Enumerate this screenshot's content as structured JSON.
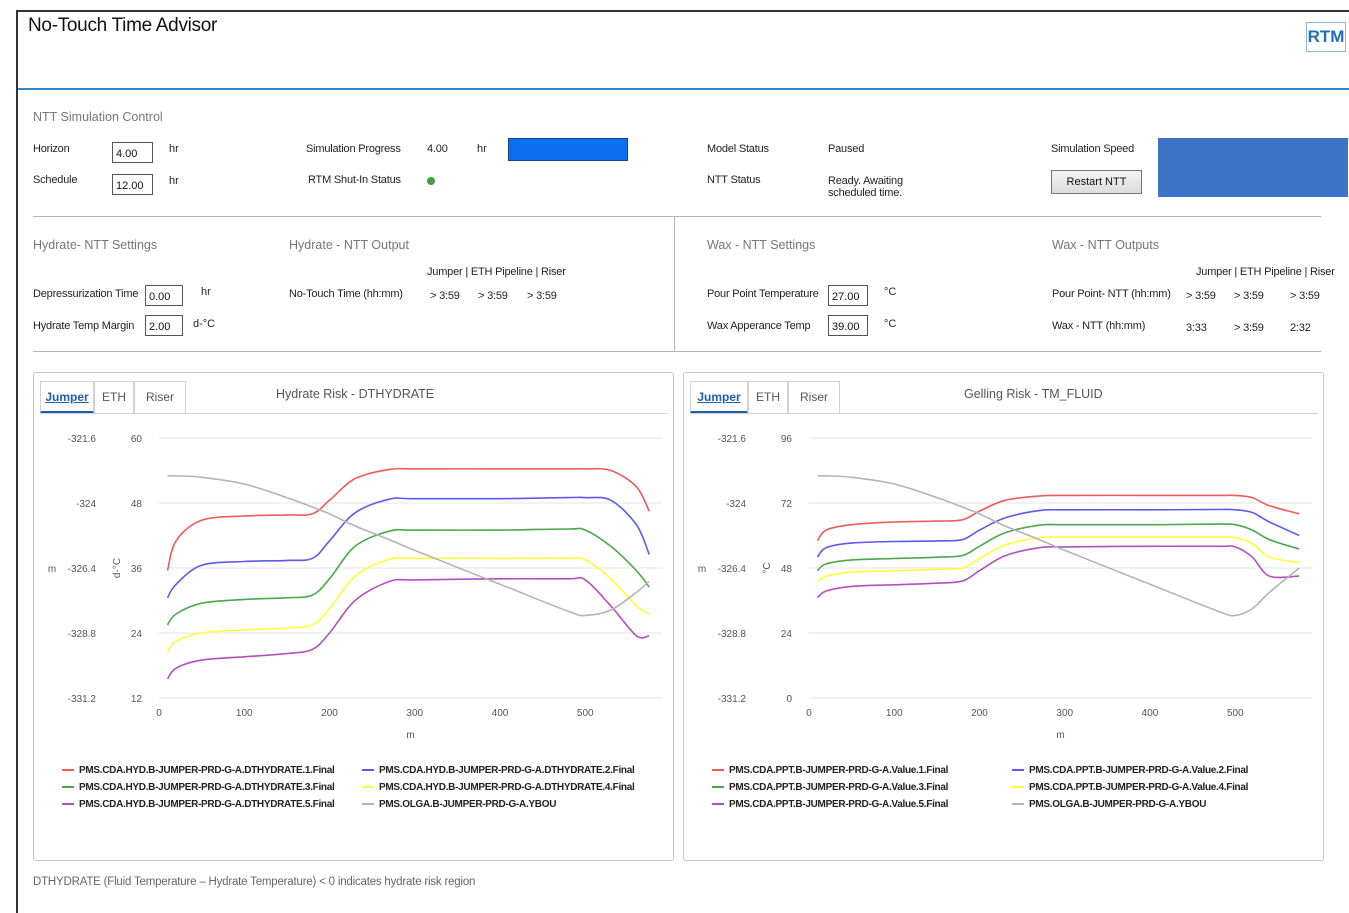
{
  "app": {
    "title": "No-Touch Time Advisor",
    "rtm_tab": "RTM"
  },
  "control": {
    "title": "NTT Simulation Control",
    "horizon_label": "Horizon",
    "horizon_value": "4.00",
    "horizon_unit": "hr",
    "schedule_label": "Schedule",
    "schedule_value": "12.00",
    "schedule_unit": "hr",
    "sim_progress_label": "Simulation Progress",
    "sim_progress_value": "4.00",
    "sim_progress_unit": "hr",
    "progress_fraction": 1.0,
    "rtm_shutin_label": "RTM Shut-In Status",
    "rtm_shutin_color": "#3ba33b",
    "model_status_label": "Model Status",
    "model_status_value": "Paused",
    "ntt_status_label": "NTT Status",
    "ntt_status_value_1": "Ready. Awaiting",
    "ntt_status_value_2": "scheduled time.",
    "sim_speed_label": "Simulation Speed",
    "restart_button": "Restart NTT"
  },
  "hydrate_settings": {
    "title": "Hydrate- NTT Settings",
    "depress_label": "Depressurization Time",
    "depress_value": "0.00",
    "depress_unit": "hr",
    "margin_label": "Hydrate Temp Margin",
    "margin_value": "2.00",
    "margin_unit": "d-°C"
  },
  "hydrate_output": {
    "title": "Hydrate - NTT Output",
    "columns": "Jumper | ETH Pipeline | Riser",
    "ntt_label": "No-Touch Time (hh:mm)",
    "values": [
      "> 3:59",
      "> 3:59",
      "> 3:59"
    ]
  },
  "wax_settings": {
    "title": "Wax - NTT Settings",
    "pour_label": "Pour Point Temperature",
    "pour_value": "27.00",
    "pour_unit": "°C",
    "wat_label": "Wax Apperance Temp",
    "wat_value": "39.00",
    "wat_unit": "°C"
  },
  "wax_output": {
    "title": "Wax - NTT Outputs",
    "columns": "Jumper | ETH Pipeline | Riser",
    "pour_label": "Pour Point- NTT (hh:mm)",
    "pour_values": [
      "> 3:59",
      "> 3:59",
      "> 3:59"
    ],
    "wax_label": "Wax - NTT (hh:mm)",
    "wax_values": [
      "3:33",
      "> 3:59",
      "2:32"
    ]
  },
  "tabs": [
    "Jumper",
    "ETH",
    "Riser"
  ],
  "footnote": "DTHYDRATE (Fluid Temperature – Hydrate Temperature) < 0 indicates hydrate risk region",
  "chart_data": [
    {
      "type": "line",
      "title": "Hydrate Risk - DTHYDRATE",
      "xlabel": "m",
      "ylabel_left": "m",
      "ylabel_right": "d-°C",
      "xlim": [
        0,
        590
      ],
      "x_ticks": [
        "0",
        "100",
        "200",
        "300",
        "400",
        "500"
      ],
      "ylim": [
        12,
        60
      ],
      "y_ticks": [
        "60",
        "48",
        "36",
        "24",
        "12"
      ],
      "y2lim": [
        -331.2,
        -321.6
      ],
      "y2_ticks": [
        "-321.6",
        "-324",
        "-326.4",
        "-328.8",
        "-331.2"
      ],
      "grid": true,
      "legend": "bottom",
      "x": [
        10,
        20,
        50,
        100,
        150,
        180,
        200,
        230,
        270,
        300,
        400,
        480,
        500,
        530,
        560,
        575
      ],
      "series": [
        {
          "name": "PMS.CDA.HYD.B-JUMPER-PRD-G-A.DTHYDRATE.1.Final",
          "color": "#f05a5a",
          "axis": "right",
          "values": [
            35.5,
            41,
            44.8,
            45.6,
            45.8,
            46,
            48.5,
            52.5,
            54.2,
            54.3,
            54.3,
            54.3,
            54.3,
            54,
            51,
            46.5
          ]
        },
        {
          "name": "PMS.CDA.HYD.B-JUMPER-PRD-G-A.DTHYDRATE.2.Final",
          "color": "#5a5af0",
          "axis": "right",
          "values": [
            30.5,
            33,
            36.5,
            37.2,
            37.4,
            37.8,
            41,
            46.2,
            48.7,
            48.8,
            48.8,
            49,
            49,
            48.5,
            44,
            38.5
          ]
        },
        {
          "name": "PMS.CDA.HYD.B-JUMPER-PRD-G-A.DTHYDRATE.3.Final",
          "color": "#4aa84a",
          "axis": "right",
          "values": [
            25.5,
            27.5,
            29.5,
            30.2,
            30.5,
            31,
            34,
            40,
            42.8,
            43,
            43,
            43.2,
            43,
            40,
            35.5,
            32.5
          ]
        },
        {
          "name": "PMS.CDA.HYD.B-JUMPER-PRD-G-A.DTHYDRATE.4.Final",
          "color": "#ffff3a",
          "axis": "right",
          "values": [
            20.5,
            22.5,
            24,
            24.6,
            24.9,
            25.5,
            28.5,
            34.5,
            37.6,
            37.8,
            37.8,
            37.8,
            37.5,
            34,
            29,
            27.5
          ]
        },
        {
          "name": "PMS.CDA.HYD.B-JUMPER-PRD-G-A.DTHYDRATE.5.Final",
          "color": "#b050c0",
          "axis": "right",
          "values": [
            15.5,
            17.5,
            19,
            19.6,
            20.2,
            21,
            24,
            30,
            33.5,
            33.8,
            34,
            34,
            33.8,
            29,
            23.5,
            23.5
          ]
        },
        {
          "name": "PMS.OLGA.B-JUMPER-PRD-G-A.YBOU",
          "color": "#b4b4b4",
          "axis": "left",
          "values": [
            -323.0,
            -323.0,
            -323.05,
            -323.3,
            -323.8,
            -324.15,
            -324.4,
            -324.85,
            -325.35,
            -325.75,
            -327.0,
            -328.0,
            -328.15,
            -327.95,
            -327.3,
            -326.9
          ]
        }
      ]
    },
    {
      "type": "line",
      "title": "Gelling Risk - TM_FLUID",
      "xlabel": "m",
      "ylabel_left": "m",
      "ylabel_right": "°C",
      "xlim": [
        0,
        590
      ],
      "x_ticks": [
        "0",
        "100",
        "200",
        "300",
        "400",
        "500"
      ],
      "ylim": [
        0,
        96
      ],
      "y_ticks": [
        "96",
        "72",
        "48",
        "24",
        "0"
      ],
      "y2lim": [
        -331.2,
        -321.6
      ],
      "y2_ticks": [
        "-321.6",
        "-324",
        "-326.4",
        "-328.8",
        "-331.2"
      ],
      "grid": true,
      "legend": "bottom",
      "x": [
        10,
        20,
        50,
        100,
        150,
        180,
        200,
        230,
        270,
        300,
        400,
        480,
        500,
        520,
        540,
        575
      ],
      "series": [
        {
          "name": "PMS.CDA.PPT.B-JUMPER-PRD-G-A.Value.1.Final",
          "color": "#f05a5a",
          "axis": "right",
          "values": [
            58,
            62,
            64,
            65,
            65.3,
            65.8,
            69,
            73,
            74.6,
            74.8,
            74.8,
            74.8,
            74.8,
            74,
            71,
            68
          ]
        },
        {
          "name": "PMS.CDA.PPT.B-JUMPER-PRD-G-A.Value.2.Final",
          "color": "#5a5af0",
          "axis": "right",
          "values": [
            52,
            55.5,
            57.2,
            57.8,
            58,
            58.5,
            62,
            66.5,
            69.2,
            69.5,
            69.5,
            69.6,
            69.5,
            68.5,
            65,
            60
          ]
        },
        {
          "name": "PMS.CDA.PPT.B-JUMPER-PRD-G-A.Value.3.Final",
          "color": "#4aa84a",
          "axis": "right",
          "values": [
            47,
            49.5,
            51,
            51.5,
            52,
            52.6,
            56,
            61,
            63.8,
            64,
            64,
            64.2,
            64,
            62,
            58.5,
            55
          ]
        },
        {
          "name": "PMS.CDA.PPT.B-JUMPER-PRD-G-A.Value.4.Final",
          "color": "#ffff3a",
          "axis": "right",
          "values": [
            43,
            45,
            46.5,
            47,
            47.5,
            48,
            51.5,
            56.5,
            59.2,
            59.4,
            59.4,
            59.4,
            59.2,
            57,
            52,
            50
          ]
        },
        {
          "name": "PMS.CDA.PPT.B-JUMPER-PRD-G-A.Value.5.Final",
          "color": "#b050c0",
          "axis": "right",
          "values": [
            37,
            39.5,
            41.2,
            41.8,
            42.4,
            43.2,
            47,
            52.5,
            55.5,
            55.8,
            56,
            56,
            55.8,
            52,
            45,
            45
          ]
        },
        {
          "name": "PMS.OLGA.B-JUMPER-PRD-G-A.YBOU",
          "color": "#b4b4b4",
          "axis": "left",
          "values": [
            -323.0,
            -323.0,
            -323.05,
            -323.3,
            -323.8,
            -324.15,
            -324.4,
            -324.85,
            -325.35,
            -325.75,
            -327.0,
            -328.0,
            -328.15,
            -327.9,
            -327.3,
            -326.4
          ]
        }
      ]
    }
  ]
}
